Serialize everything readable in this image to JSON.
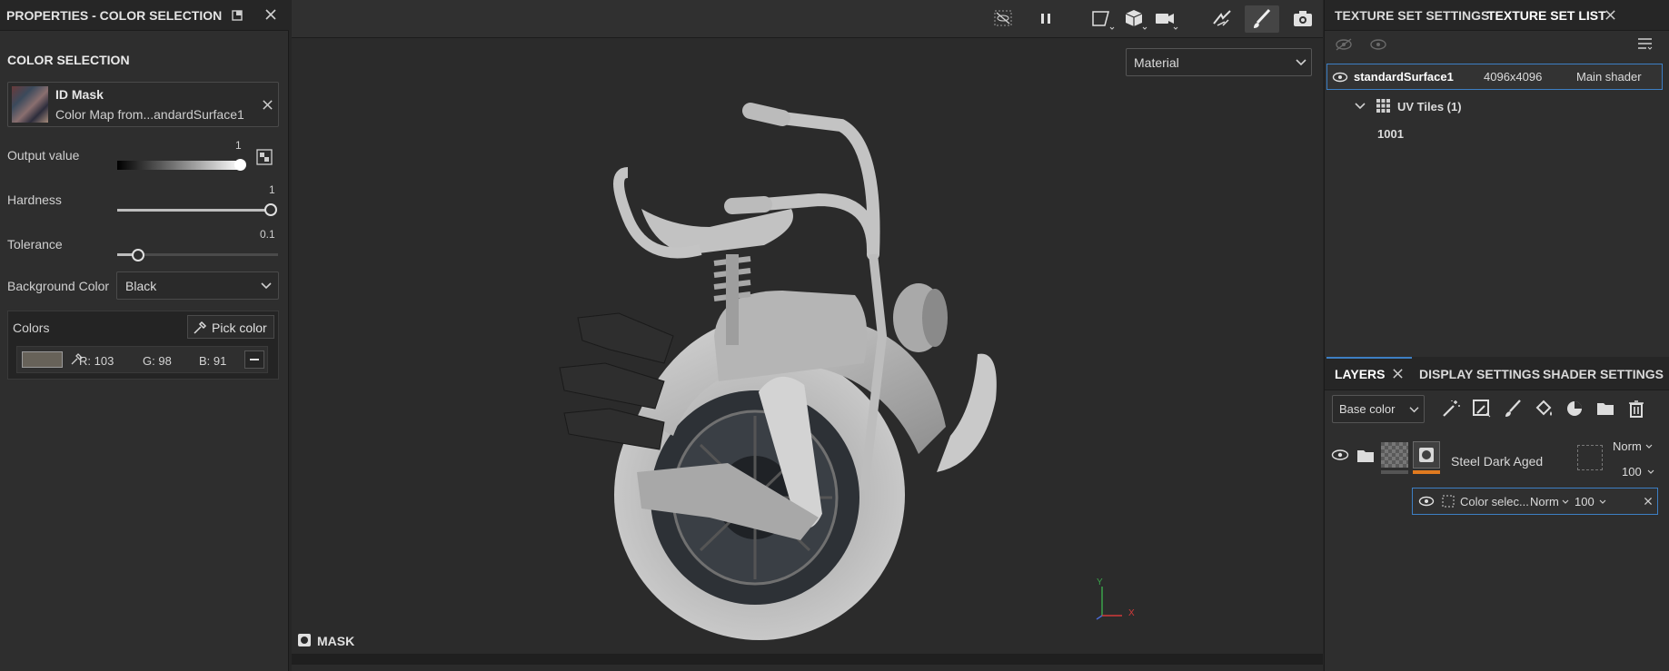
{
  "left": {
    "panel_title": "PROPERTIES - COLOR SELECTION",
    "section_title": "COLOR SELECTION",
    "id_mask": {
      "title": "ID Mask",
      "subtitle": "Color Map from...andardSurface1"
    },
    "output_value": {
      "label": "Output value",
      "value": "1",
      "level": 1
    },
    "hardness": {
      "label": "Hardness",
      "value": "1",
      "level": 1
    },
    "tolerance": {
      "label": "Tolerance",
      "value": "0.1",
      "level": 0.1
    },
    "background_color": {
      "label": "Background Color",
      "selected": "Black"
    },
    "colors": {
      "label": "Colors",
      "pick_color": "Pick color",
      "swatch_hex": "#676259",
      "r": "R: 103",
      "g": "G: 98",
      "b": "B: 91"
    }
  },
  "viewport": {
    "channel_select": "Material",
    "mask_label": "MASK",
    "axis_y": "Y",
    "axis_x": "X",
    "toolbar_icons": [
      "visibility-off-icon",
      "pause-icon",
      "selection-icon",
      "cube-icon",
      "camera-icon",
      "symmetry-icon",
      "paintbrush-icon",
      "screenshot-icon"
    ]
  },
  "right": {
    "texture_tabs": [
      "TEXTURE SET SETTINGS",
      "TEXTURE SET LIST"
    ],
    "texture_set": {
      "name": "standardSurface1",
      "size": "4096x4096",
      "shader": "Main shader"
    },
    "uv_tiles": "UV Tiles (1)",
    "tile": "1001",
    "layer_tabs": [
      "LAYERS",
      "DISPLAY SETTINGS",
      "SHADER SETTINGS"
    ],
    "channel": "Base color",
    "layer": {
      "name": "Steel Dark Aged",
      "blend": "Norm",
      "opacity": "100"
    },
    "sublayer": {
      "name": "Color selec...",
      "blend": "Norm",
      "opacity": "100"
    }
  },
  "colors": {
    "accent": "#3d7fc4",
    "orange": "#e07a1f",
    "panel": "#2e2e2e"
  }
}
